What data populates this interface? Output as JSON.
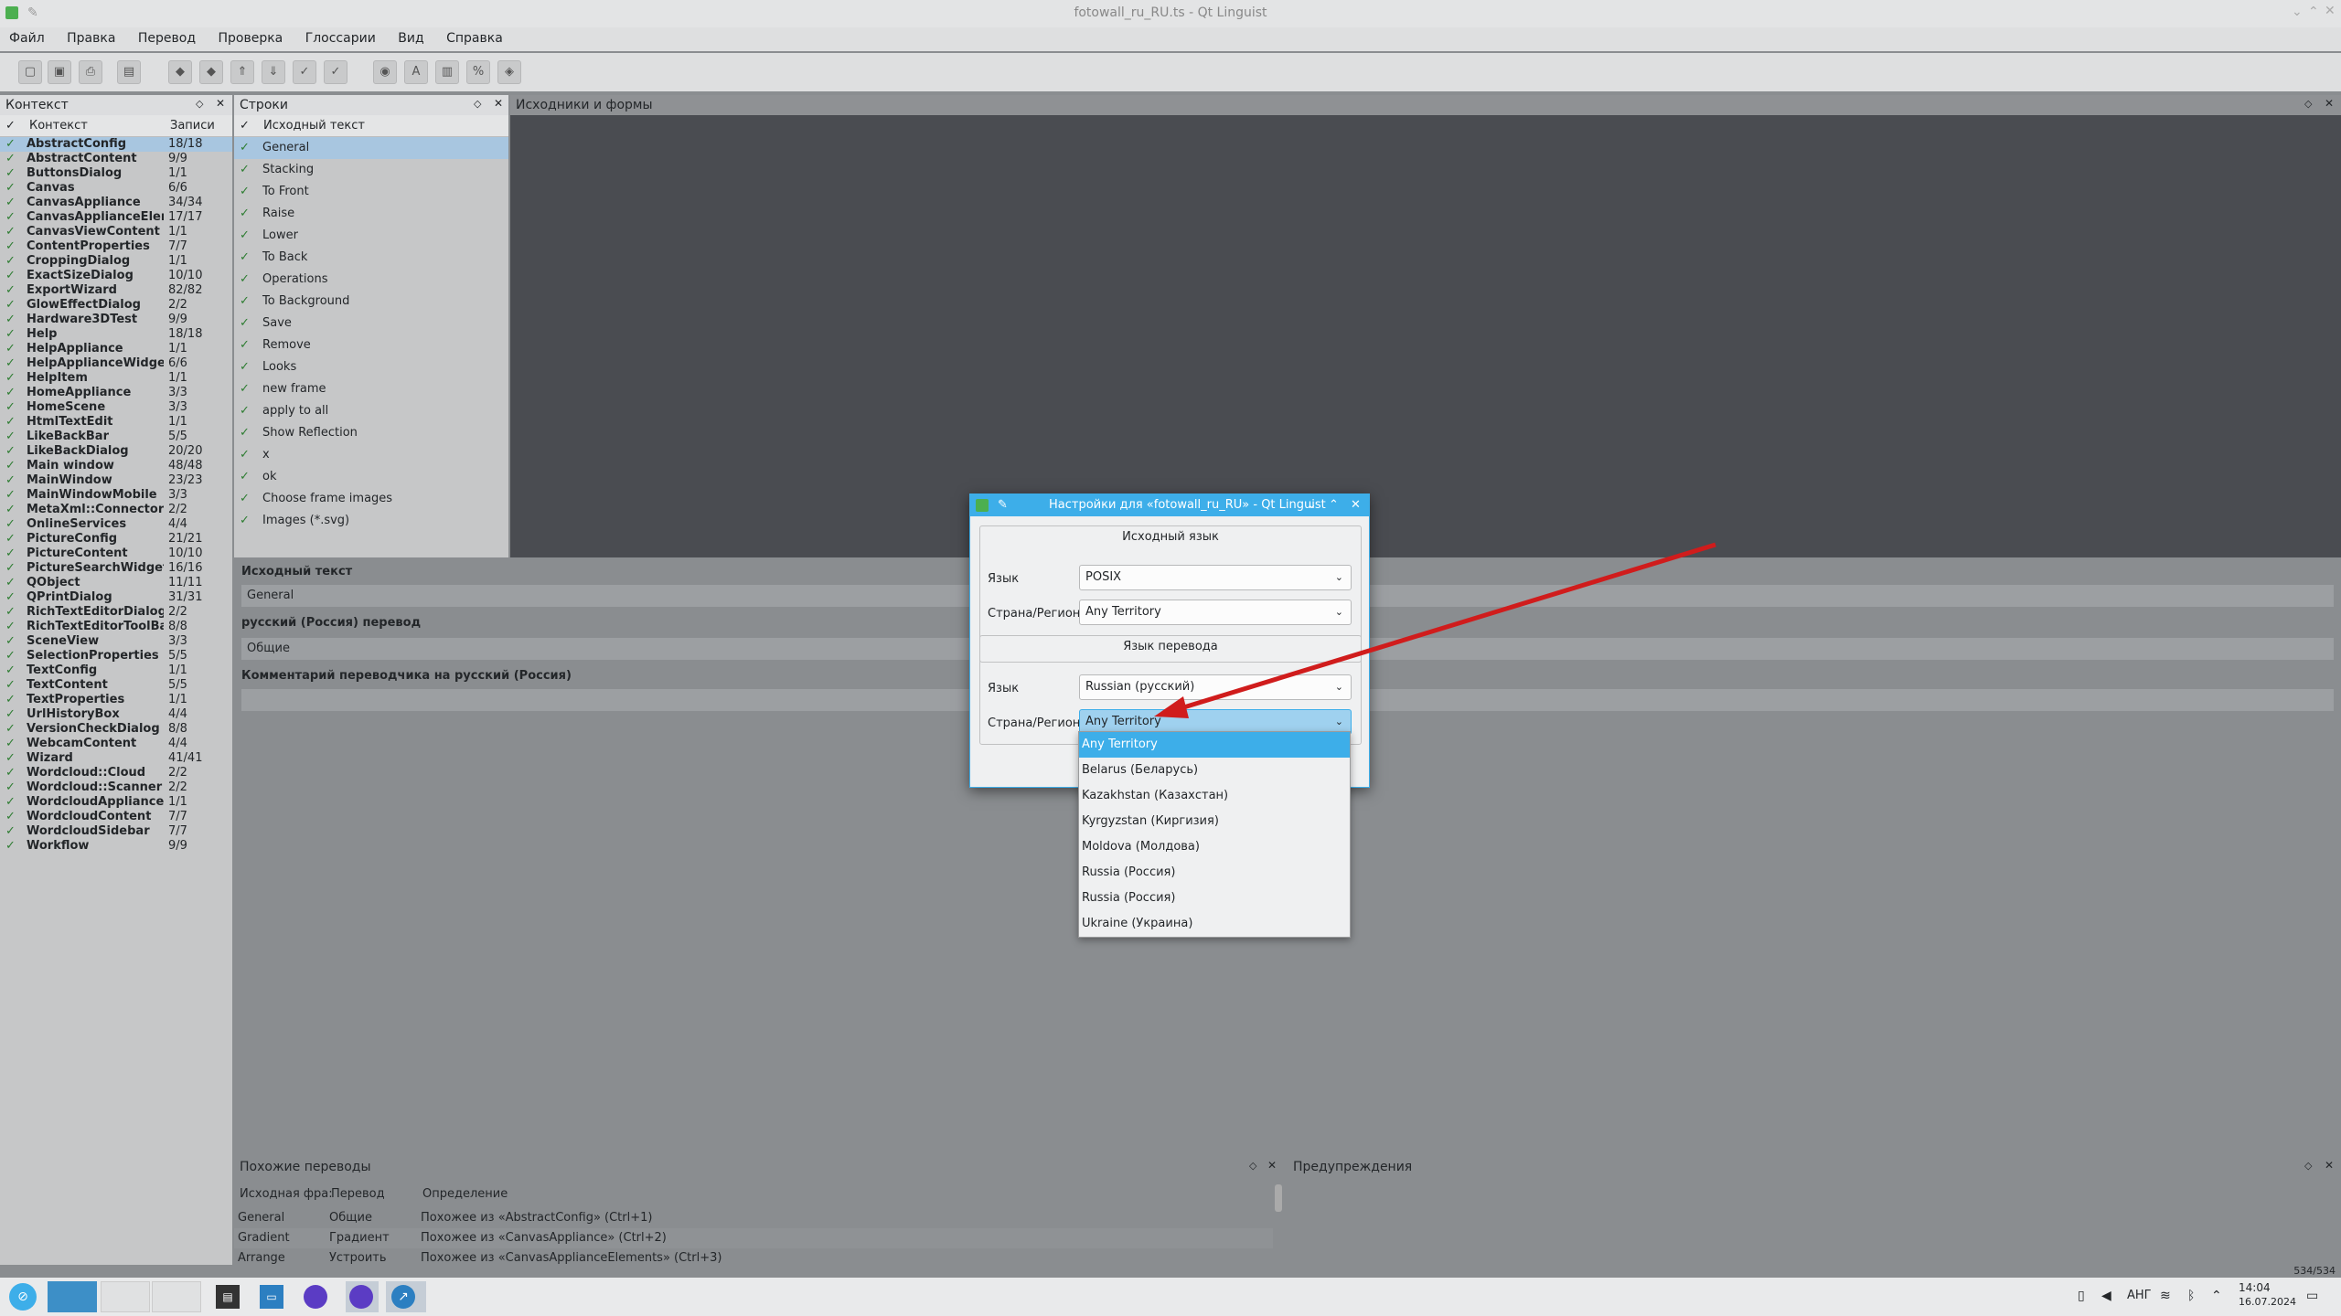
{
  "window": {
    "title": "fotowall_ru_RU.ts - Qt Linguist"
  },
  "menu": [
    "Файл",
    "Правка",
    "Перевод",
    "Проверка",
    "Глоссарии",
    "Вид",
    "Справка"
  ],
  "context": {
    "title": "Контекст",
    "col_ctx": "Контекст",
    "col_count": "Записи",
    "items": [
      {
        "name": "AbstractConfig",
        "count": "18/18"
      },
      {
        "name": "AbstractContent",
        "count": "9/9"
      },
      {
        "name": "ButtonsDialog",
        "count": "1/1"
      },
      {
        "name": "Canvas",
        "count": "6/6"
      },
      {
        "name": "CanvasAppliance",
        "count": "34/34"
      },
      {
        "name": "CanvasApplianceEleme...",
        "count": "17/17"
      },
      {
        "name": "CanvasViewContent",
        "count": "1/1"
      },
      {
        "name": "ContentProperties",
        "count": "7/7"
      },
      {
        "name": "CroppingDialog",
        "count": "1/1"
      },
      {
        "name": "ExactSizeDialog",
        "count": "10/10"
      },
      {
        "name": "ExportWizard",
        "count": "82/82"
      },
      {
        "name": "GlowEffectDialog",
        "count": "2/2"
      },
      {
        "name": "Hardware3DTest",
        "count": "9/9"
      },
      {
        "name": "Help",
        "count": "18/18"
      },
      {
        "name": "HelpAppliance",
        "count": "1/1"
      },
      {
        "name": "HelpApplianceWidgets",
        "count": "6/6"
      },
      {
        "name": "HelpItem",
        "count": "1/1"
      },
      {
        "name": "HomeAppliance",
        "count": "3/3"
      },
      {
        "name": "HomeScene",
        "count": "3/3"
      },
      {
        "name": "HtmlTextEdit",
        "count": "1/1"
      },
      {
        "name": "LikeBackBar",
        "count": "5/5"
      },
      {
        "name": "LikeBackDialog",
        "count": "20/20"
      },
      {
        "name": "Main window",
        "count": "48/48"
      },
      {
        "name": "MainWindow",
        "count": "23/23"
      },
      {
        "name": "MainWindowMobile",
        "count": "3/3"
      },
      {
        "name": "MetaXml::Connector",
        "count": "2/2"
      },
      {
        "name": "OnlineServices",
        "count": "4/4"
      },
      {
        "name": "PictureConfig",
        "count": "21/21"
      },
      {
        "name": "PictureContent",
        "count": "10/10"
      },
      {
        "name": "PictureSearchWidget",
        "count": "16/16"
      },
      {
        "name": "QObject",
        "count": "11/11"
      },
      {
        "name": "QPrintDialog",
        "count": "31/31"
      },
      {
        "name": "RichTextEditorDialog",
        "count": "2/2"
      },
      {
        "name": "RichTextEditorToolBar",
        "count": "8/8"
      },
      {
        "name": "SceneView",
        "count": "3/3"
      },
      {
        "name": "SelectionProperties",
        "count": "5/5"
      },
      {
        "name": "TextConfig",
        "count": "1/1"
      },
      {
        "name": "TextContent",
        "count": "5/5"
      },
      {
        "name": "TextProperties",
        "count": "1/1"
      },
      {
        "name": "UrlHistoryBox",
        "count": "4/4"
      },
      {
        "name": "VersionCheckDialog",
        "count": "8/8"
      },
      {
        "name": "WebcamContent",
        "count": "4/4"
      },
      {
        "name": "Wizard",
        "count": "41/41"
      },
      {
        "name": "Wordcloud::Cloud",
        "count": "2/2"
      },
      {
        "name": "Wordcloud::Scanner",
        "count": "2/2"
      },
      {
        "name": "WordcloudAppliance",
        "count": "1/1"
      },
      {
        "name": "WordcloudContent",
        "count": "7/7"
      },
      {
        "name": "WordcloudSidebar",
        "count": "7/7"
      },
      {
        "name": "Workflow",
        "count": "9/9"
      }
    ]
  },
  "strings": {
    "title": "Строки",
    "col_source": "Исходный текст",
    "items": [
      "General",
      "Stacking",
      "To Front",
      "Raise",
      "Lower",
      "To Back",
      "Operations",
      "To Background",
      "Save",
      "Remove",
      "Looks",
      "new frame",
      "apply to all",
      "Show Reflection",
      "x",
      "ok",
      "Choose frame images",
      "Images (*.svg)"
    ]
  },
  "sources": {
    "title": "Исходники и формы"
  },
  "editor": {
    "source_label": "Исходный текст",
    "source_value": "General",
    "translation_label": "русский (Россия) перевод",
    "translation_value": "Общие",
    "comment_label": "Комментарий переводчика на русский (Россия)"
  },
  "phrases": {
    "title": "Похожие переводы",
    "col1": "Исходная фра:",
    "col2": "Перевод",
    "col3": "Определение",
    "rows": [
      {
        "src": "General",
        "tr": "Общие",
        "def": "Похожее из «AbstractConfig» (Ctrl+1)"
      },
      {
        "src": "Gradient",
        "tr": "Градиент",
        "def": "Похожее из «CanvasAppliance» (Ctrl+2)"
      },
      {
        "src": "Arrange",
        "tr": "Устроить",
        "def": "Похожее из «CanvasApplianceElements» (Ctrl+3)"
      }
    ]
  },
  "warnings": {
    "title": "Предупреждения"
  },
  "status": {
    "count": "534/534"
  },
  "tray": {
    "lang": "АНГ",
    "time": "14:04",
    "date": "16.07.2024"
  },
  "dialog": {
    "title": "Настройки для «fotowall_ru_RU» - Qt Linguist",
    "src_group": "Исходный язык",
    "lang_label": "Язык",
    "region_label": "Страна/Регион",
    "src_lang": "POSIX",
    "src_region": "Any Territory",
    "tr_group": "Язык перевода",
    "tr_lang": "Russian (русский)",
    "tr_region": "Any Territory",
    "options": [
      "Any Territory",
      "Belarus (Беларусь)",
      "Kazakhstan (Казахстан)",
      "Kyrgyzstan (Киргизия)",
      "Moldova (Молдова)",
      "Russia (Россия)",
      "Russia (Россия)",
      "Ukraine (Украина)"
    ]
  },
  "colors": {
    "accent": "#3daee9",
    "arrow": "#d01c1c",
    "check": "#2e7d32"
  }
}
